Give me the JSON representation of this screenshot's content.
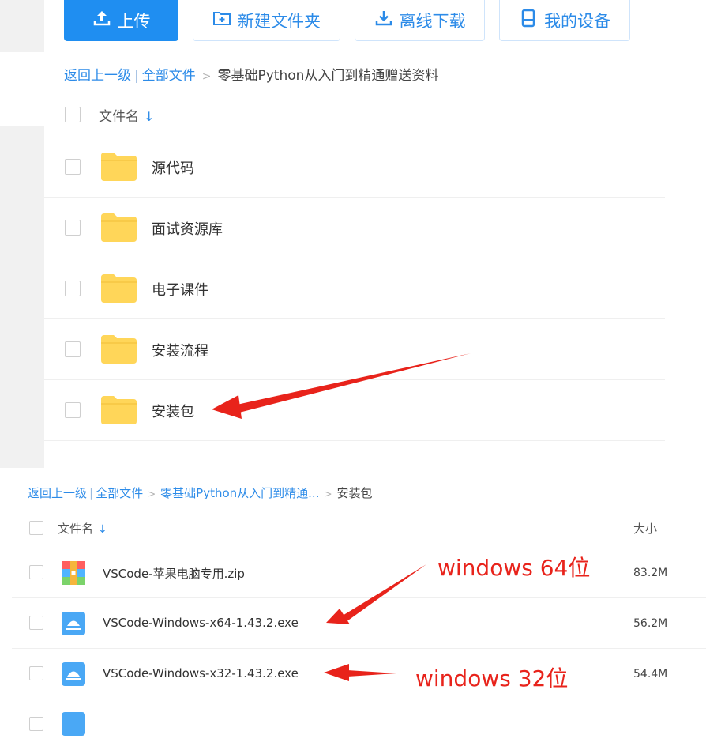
{
  "toolbar": {
    "upload_label": "上传",
    "new_folder_label": "新建文件夹",
    "offline_download_label": "离线下载",
    "my_devices_label": "我的设备"
  },
  "breadcrumb_top": {
    "back": "返回上一级",
    "all_files": "全部文件",
    "current": "零基础Python从入门到精通赠送资料"
  },
  "list_top": {
    "header_name": "文件名",
    "folders": [
      {
        "name": "源代码"
      },
      {
        "name": "面试资源库"
      },
      {
        "name": "电子课件"
      },
      {
        "name": "安装流程"
      },
      {
        "name": "安装包"
      }
    ]
  },
  "breadcrumb_bottom": {
    "back": "返回上一级",
    "all_files": "全部文件",
    "parent": "零基础Python从入门到精通...",
    "current": "安装包"
  },
  "list_bottom": {
    "header_name": "文件名",
    "header_size": "大小",
    "files": [
      {
        "name": "VSCode-苹果电脑专用.zip",
        "size": "83.2M",
        "icon": "zip-archive-icon"
      },
      {
        "name": "VSCode-Windows-x64-1.43.2.exe",
        "size": "56.2M",
        "icon": "exe-installer-icon"
      },
      {
        "name": "VSCode-Windows-x32-1.43.2.exe",
        "size": "54.4M",
        "icon": "exe-installer-icon"
      }
    ]
  },
  "annotations": {
    "win64": "windows 64位",
    "win32": "windows 32位"
  },
  "colors": {
    "accent": "#1f8ef1",
    "annotation": "#e8231b",
    "folder": "#ffd659"
  }
}
